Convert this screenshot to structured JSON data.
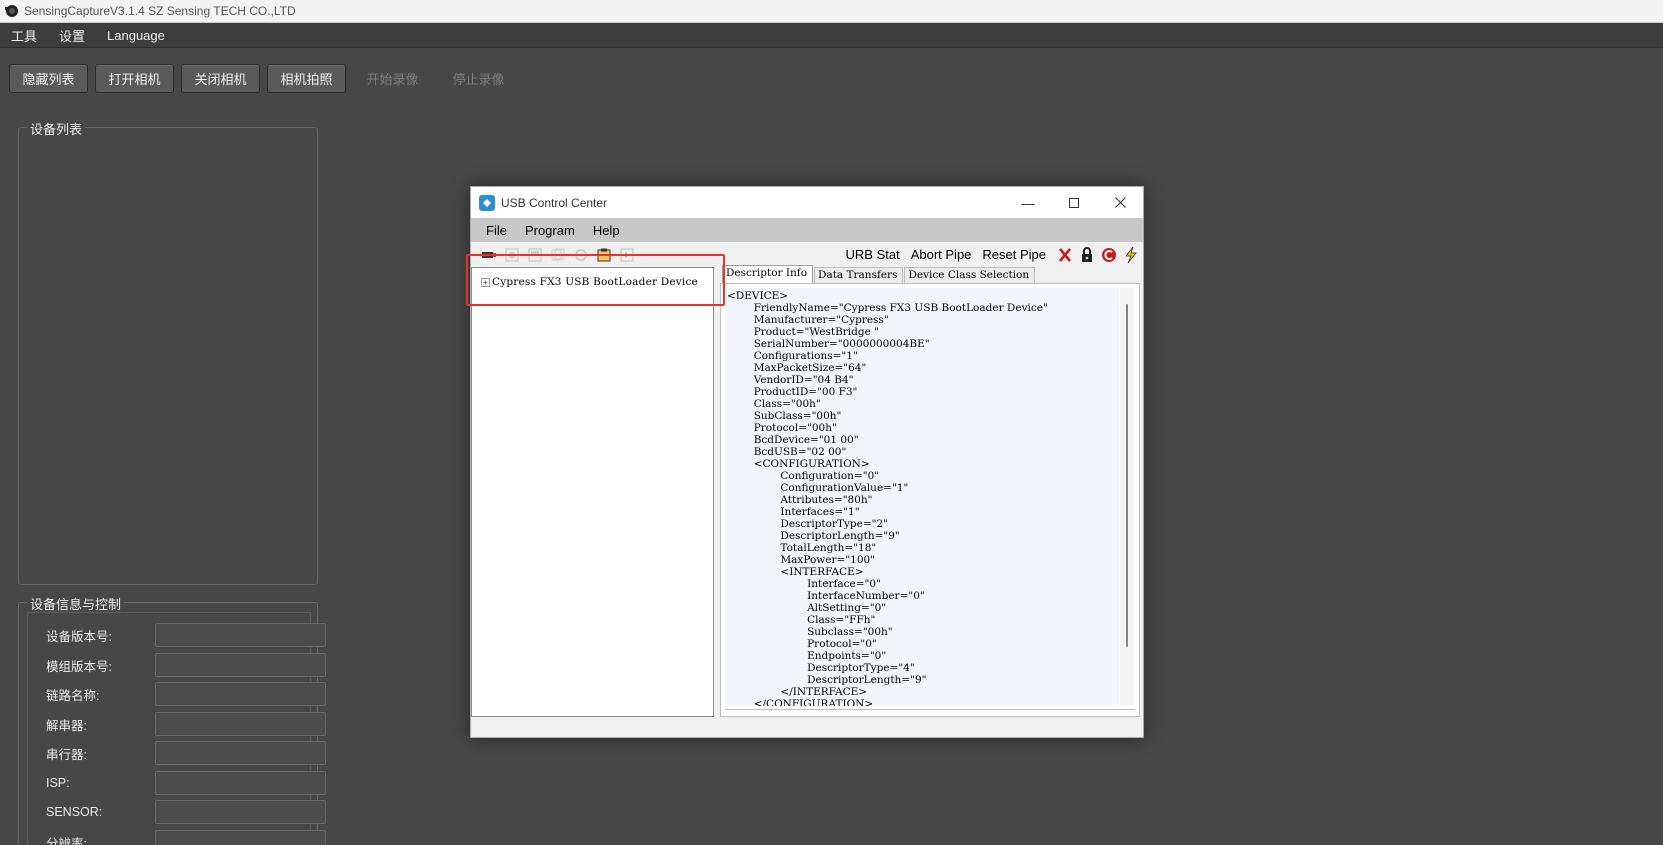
{
  "app": {
    "title": "SensingCaptureV3.1.4 SZ Sensing TECH CO.,LTD",
    "menu": [
      "工具",
      "设置",
      "Language"
    ],
    "toolbar": [
      {
        "label": "隐藏列表",
        "enabled": true
      },
      {
        "label": "打开相机",
        "enabled": true
      },
      {
        "label": "关闭相机",
        "enabled": true
      },
      {
        "label": "相机拍照",
        "enabled": true
      },
      {
        "label": "开始录像",
        "enabled": false
      },
      {
        "label": "停止录像",
        "enabled": false
      }
    ],
    "device_list_title": "设备列表",
    "device_info_title": "设备信息与控制",
    "fields": [
      {
        "label": "设备版本号:",
        "value": ""
      },
      {
        "label": "模组版本号:",
        "value": ""
      },
      {
        "label": "链路名称:",
        "value": ""
      },
      {
        "label": "解串器:",
        "value": ""
      },
      {
        "label": "串行器:",
        "value": ""
      },
      {
        "label": "ISP:",
        "value": ""
      },
      {
        "label": "SENSOR:",
        "value": ""
      },
      {
        "label": "分辨率:",
        "value": ""
      }
    ]
  },
  "usb_window": {
    "title": "USB Control Center",
    "menu": [
      "File",
      "Program",
      "Help"
    ],
    "toolbar_right": [
      "URB Stat",
      "Abort Pipe",
      "Reset Pipe"
    ],
    "tree_item": "Cypress FX3 USB BootLoader Device",
    "tabs": [
      "Descriptor Info",
      "Data Transfers",
      "Device Class Selection"
    ],
    "descriptor_text": "<DEVICE>\n        FriendlyName=\"Cypress FX3 USB BootLoader Device\"\n        Manufacturer=\"Cypress\"\n        Product=\"WestBridge \"\n        SerialNumber=\"0000000004BE\"\n        Configurations=\"1\"\n        MaxPacketSize=\"64\"\n        VendorID=\"04 B4\"\n        ProductID=\"00 F3\"\n        Class=\"00h\"\n        SubClass=\"00h\"\n        Protocol=\"00h\"\n        BcdDevice=\"01 00\"\n        BcdUSB=\"02 00\"\n        <CONFIGURATION>\n                Configuration=\"0\"\n                ConfigurationValue=\"1\"\n                Attributes=\"80h\"\n                Interfaces=\"1\"\n                DescriptorType=\"2\"\n                DescriptorLength=\"9\"\n                TotalLength=\"18\"\n                MaxPower=\"100\"\n                <INTERFACE>\n                        Interface=\"0\"\n                        InterfaceNumber=\"0\"\n                        AltSetting=\"0\"\n                        Class=\"FFh\"\n                        Subclass=\"00h\"\n                        Protocol=\"0\"\n                        Endpoints=\"0\"\n                        DescriptorType=\"4\"\n                        DescriptorLength=\"9\"\n                </INTERFACE>\n        </CONFIGURATION>"
  },
  "colors": {
    "background": "#474747",
    "highlight": "#e8332a",
    "window_accent": "#2c8fd6"
  }
}
